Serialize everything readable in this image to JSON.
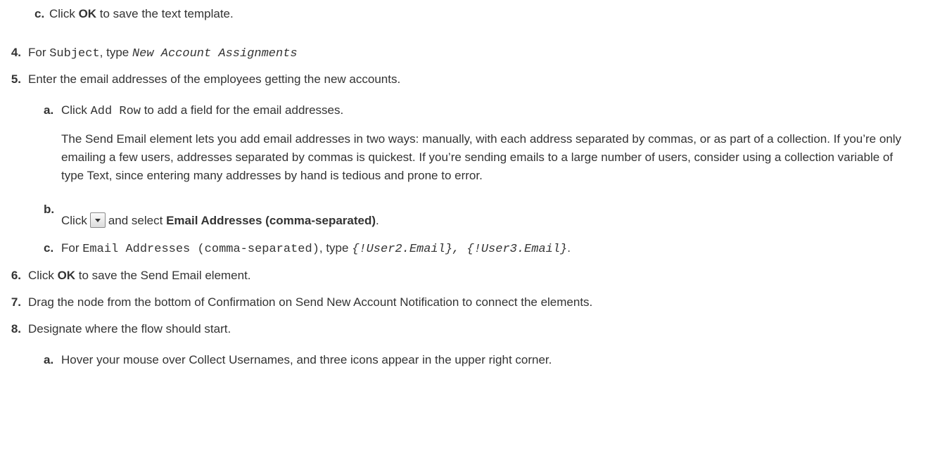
{
  "steps": {
    "c_ok": {
      "letter": "c.",
      "p1": "Click ",
      "bold": "OK",
      "p2": " to save the text template."
    },
    "s4": {
      "num": "4.",
      "p1": "For ",
      "code": "Subject",
      "p2": ", type ",
      "value": "New Account Assignments"
    },
    "s5": {
      "num": "5.",
      "text": "Enter the email addresses of the employees getting the new accounts."
    },
    "s5a": {
      "letter": "a.",
      "p1": "Click ",
      "code": "Add Row",
      "p2": " to add a field for the email addresses."
    },
    "s5a_para": "The Send Email element lets you add email addresses in two ways: manually, with each address separated by commas, or as part of a collection. If you’re only emailing a few users, addresses separated by commas is quickest. If you’re sending emails to a large number of users, consider using a collection variable of type Text, since entering many addresses by hand is tedious and prone to error.",
    "s5b": {
      "letter": "b.",
      "p1": "Click",
      "icon": "dropdown-arrow-icon",
      "p2": "and select ",
      "bold": "Email Addresses (comma-separated)",
      "p3": "."
    },
    "s5c": {
      "letter": "c.",
      "p1": "For ",
      "code": "Email Addresses (comma-separated)",
      "p2": ", type ",
      "value": "{!User2.Email}, {!User3.Email}",
      "p3": "."
    },
    "s6": {
      "num": "6.",
      "p1": "Click ",
      "bold": "OK",
      "p2": " to save the Send Email element."
    },
    "s7": {
      "num": "7.",
      "text": "Drag the node from the bottom of Confirmation on Send New Account Notification to connect the elements."
    },
    "s8": {
      "num": "8.",
      "text": "Designate where the flow should start."
    },
    "s8a": {
      "letter": "a.",
      "text": "Hover your mouse over Collect Usernames, and three icons appear in the upper right corner."
    }
  }
}
